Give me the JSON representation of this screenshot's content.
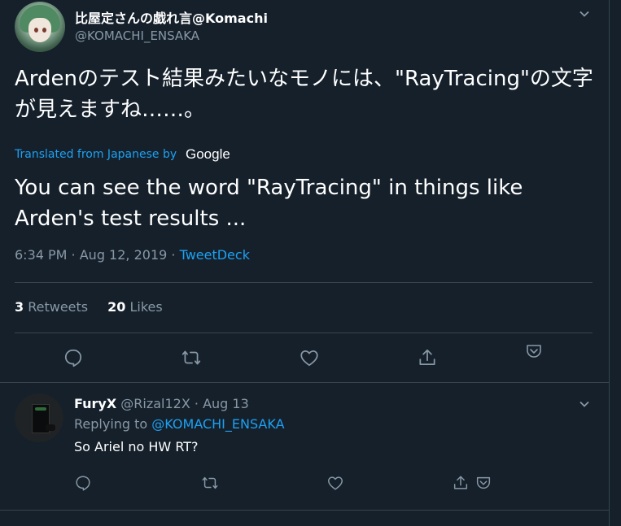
{
  "tweet": {
    "display_name": "比屋定さんの戯れ言@Komachi",
    "handle": "@KOMACHI_ENSAKA",
    "text_original": "Ardenのテスト結果みたいなモノには、\"RayTracing\"の文字が見えますね……。",
    "translated_label": "Translated from Japanese by",
    "translation_provider": "Google",
    "text_translated": "You can see the word \"RayTracing\" in things like Arden's test results ...",
    "timestamp": "6:34 PM · Aug 12, 2019 · ",
    "source": "TweetDeck",
    "retweets_count": "3",
    "retweets_label": "Retweets",
    "likes_count": "20",
    "likes_label": "Likes"
  },
  "reply": {
    "display_name": "FuryX",
    "handle_date": "@Rizal12X · Aug 13",
    "replying_prefix": "Replying to ",
    "replying_to": "@KOMACHI_ENSAKA",
    "text": "So Ariel no HW RT?"
  },
  "icons": [
    "chevron-down-icon",
    "reply-icon",
    "retweet-icon",
    "like-icon",
    "share-icon",
    "pocket-icon"
  ],
  "colors": {
    "background": "#15202b",
    "link": "#1da1f2",
    "muted": "#8899a6",
    "divider": "#38444d"
  }
}
